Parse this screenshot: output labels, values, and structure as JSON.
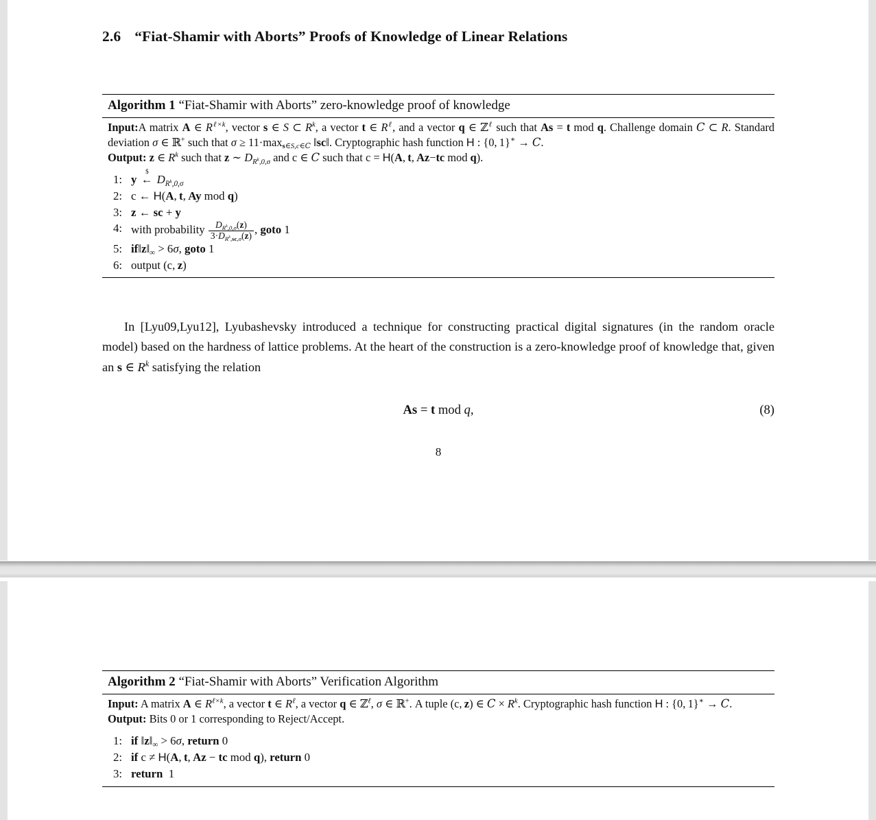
{
  "document": {
    "page_number": "8",
    "equation_number": "(8)"
  },
  "section": {
    "number": "2.6",
    "title": "“Fiat-Shamir with Aborts” Proofs of Knowledge of Linear Relations"
  },
  "algorithm1": {
    "label": "Algorithm 1",
    "title": "“Fiat-Shamir with Aborts” zero-knowledge proof of knowledge",
    "input_label": "Input:",
    "output_label": "Output:",
    "input_text": "Input:A matrix A ∈ R^{ℓ×k}, vector s ∈ S ⊂ R^k, a vector t ∈ R^ℓ, and a vector q ∈ ℤ^ℓ such that As = t mod q. Challenge domain C ⊂ R. Standard deviation σ ∈ ℝ⁺ such that σ ≥ 11·max_{s∈S,c∈C} ‖sc‖. Cryptographic hash function H : {0,1}* → C.",
    "output_text": "Output: z ∈ R^k such that z ~ D_{R^k,0,σ} and c ∈ C such that c = H(A, t, Az−tc mod q).",
    "steps": [
      "y ←$ D_{R^k,0,σ}",
      "c ← H(A, t, Ay mod q)",
      "z ← sc + y",
      "with probability D_{R^k,0,σ}(z) / (3·D_{R^k,sc,σ}(z)), goto 1",
      "if‖z‖∞ > 6σ, goto 1",
      "output (c, z)"
    ],
    "step_keywords": {
      "with_probability": "with probability",
      "goto": "goto",
      "if": "if",
      "output": "output"
    }
  },
  "paragraph": {
    "text": "In [Lyu09,Lyu12], Lyubashevsky introduced a technique for constructing practical digital signatures (in the random oracle model) based on the hardness of lattice problems. At the heart of the construction is a zero-knowledge proof of knowledge that, given an s ∈ R^k satisfying the relation",
    "citation": "[Lyu09,Lyu12]"
  },
  "equation": {
    "text": "As = t mod q,",
    "number": "(8)"
  },
  "algorithm2": {
    "label": "Algorithm 2",
    "title": "“Fiat-Shamir with Aborts” Verification Algorithm",
    "input_label": "Input:",
    "output_label": "Output:",
    "input_text": "Input: A matrix A ∈ R^{ℓ×k}, a vector t ∈ R^ℓ, a vector q ∈ ℤ^ℓ, σ ∈ ℝ⁺. A tuple (c, z) ∈ C × R^k. Cryptographic hash function H : {0,1}* → C.",
    "output_text": "Output: Bits 0 or 1 corresponding to Reject/Accept.",
    "output_body": "Bits 0 or 1 corresponding to Reject/Accept.",
    "steps": [
      "if ‖z‖∞ > 6σ, return 0",
      "if c ≠ H(A, t, Az − tc mod q), return 0",
      "return 1"
    ],
    "step_keywords": {
      "if": "if",
      "return": "return"
    }
  },
  "symbols": {
    "in": "∈",
    "subset": "⊂",
    "geq": "≥",
    "gt": ">",
    "neq": "≠",
    "times": "×",
    "to": "→",
    "gets": "←",
    "sim": "~",
    "sigma": "σ",
    "ell": "ℓ",
    "infty": "∞",
    "minus": "−",
    "cdot": "·",
    "norm": "‖",
    "star": "∗",
    "dollar": "$",
    "plus_sup": "+",
    "mod": "mod",
    "max": "max",
    "zero": "0",
    "one": "1",
    "three": "3",
    "six": "6",
    "eleven": "11"
  }
}
